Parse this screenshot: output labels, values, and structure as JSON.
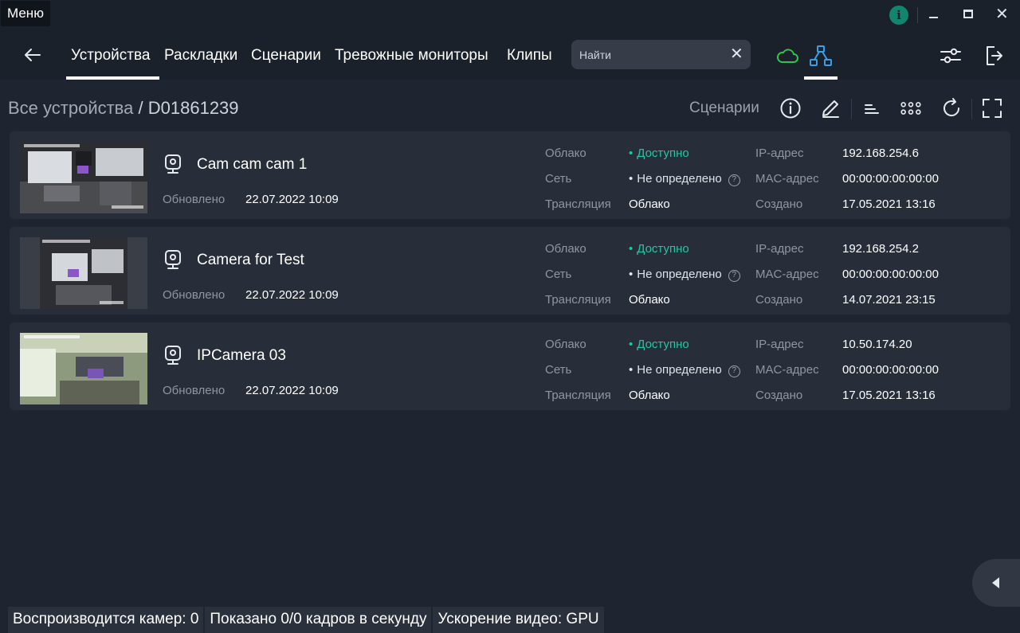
{
  "window": {
    "menu_label": "Меню",
    "info_icon": "info-icon",
    "info_glyph": "i",
    "close_glyph": "✕"
  },
  "nav": {
    "back_icon": "arrow-left-icon",
    "tabs": [
      {
        "label": "Устройства",
        "active": true
      },
      {
        "label": "Раскладки",
        "active": false
      },
      {
        "label": "Сценарии",
        "active": false
      },
      {
        "label": "Тревожные мониторы",
        "active": false
      },
      {
        "label": "Клипы",
        "active": false
      }
    ],
    "search": {
      "value": "",
      "placeholder": "Найти",
      "clear_glyph": "✕"
    },
    "cloud_color": "#2fc44a",
    "topology_color": "#3b9ee8"
  },
  "breadcrumb": {
    "root": "Все устройства",
    "separator": "/",
    "current": "D01861239"
  },
  "toolbar": {
    "scenarios_label": "Сценарии",
    "icons": [
      "info-icon",
      "edit-icon",
      "sort-icon",
      "grid-icon",
      "refresh-icon",
      "fullscreen-icon"
    ]
  },
  "labels": {
    "updated": "Обновлено",
    "cloud": "Облако",
    "network": "Сеть",
    "stream": "Трансляция",
    "ip": "IP-адрес",
    "mac": "MAC-адрес",
    "created": "Создано",
    "help_glyph": "?"
  },
  "devices": [
    {
      "name": "Cam cam cam 1",
      "updated": "22.07.2022 10:09",
      "cloud_status": "Доступно",
      "network_status": "Не определено",
      "stream": "Облако",
      "ip": "192.168.254.6",
      "mac": "00:00:00:00:00:00",
      "created": "17.05.2021 13:16"
    },
    {
      "name": "Camera for Test",
      "updated": "22.07.2022 10:09",
      "cloud_status": "Доступно",
      "network_status": "Не определено",
      "stream": "Облако",
      "ip": "192.168.254.2",
      "mac": "00:00:00:00:00:00",
      "created": "14.07.2021 23:15"
    },
    {
      "name": "IPCamera 03",
      "updated": "22.07.2022 10:09",
      "cloud_status": "Доступно",
      "network_status": "Не определено",
      "stream": "Облако",
      "ip": "10.50.174.20",
      "mac": "00:00:00:00:00:00",
      "created": "17.05.2021 13:16"
    }
  ],
  "status_bar": {
    "cameras_playing": "Воспроизводится камер: 0",
    "fps_shown": "Показано 0/0 кадров в секунду",
    "acceleration": "Ускорение видео: GPU"
  },
  "colors": {
    "available": "#1dc9a0",
    "background": "#1e2430",
    "card": "#272e3a"
  }
}
